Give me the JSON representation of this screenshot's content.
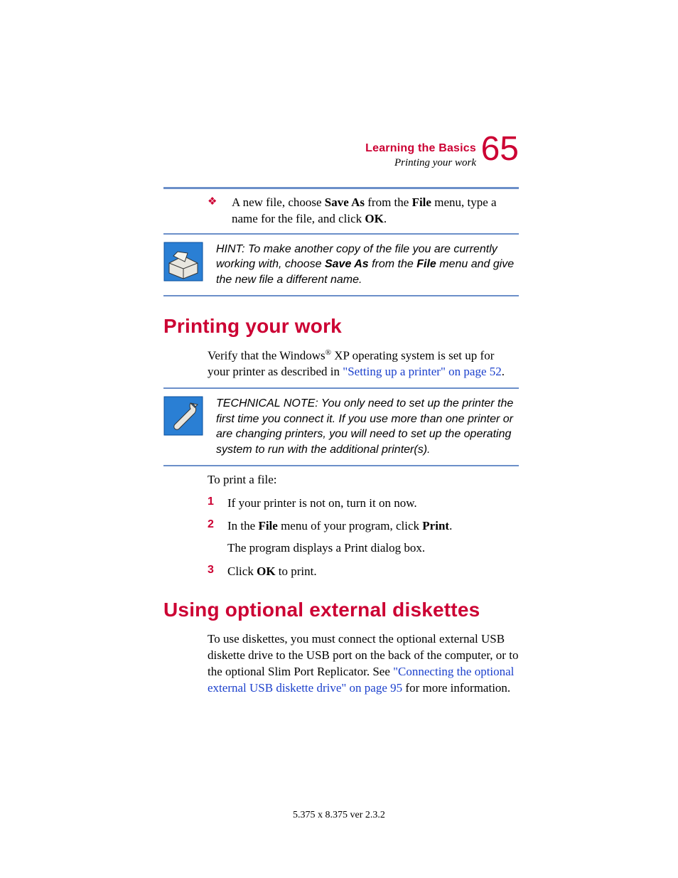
{
  "header": {
    "chapter": "Learning the Basics",
    "section": "Printing your work",
    "page": "65"
  },
  "bullet": {
    "pre": "A new file, choose ",
    "b1": "Save As",
    "mid1": " from the ",
    "b2": "File",
    "mid2": " menu, type a name for the file, and click ",
    "b3": "OK",
    "end": "."
  },
  "hint": {
    "lead": "HINT: To make another copy of the file you are currently working with, choose ",
    "b1": "Save As",
    "mid": " from the ",
    "b2": "File",
    "end": " menu and give the new file a different name."
  },
  "h2a": "Printing your work",
  "p1": {
    "t1": "Verify that the Windows",
    "reg": "®",
    "t2": " XP operating system is set up for your printer as described in ",
    "link": "\"Setting up a printer\" on page 52",
    "end": "."
  },
  "tech": "TECHNICAL NOTE: You only need to set up the printer the first time you connect it. If you use more than one printer or are changing printers, you will need to set up the operating system to run with the additional printer(s).",
  "p2": "To print a file:",
  "s1": {
    "n": "1",
    "t": "If your printer is not on, turn it on now."
  },
  "s2": {
    "n": "2",
    "pre": "In the ",
    "b1": "File",
    "mid": " menu of your program, click ",
    "b2": "Print",
    "end": ".",
    "sub": "The program displays a Print dialog box."
  },
  "s3": {
    "n": "3",
    "pre": "Click ",
    "b1": "OK",
    "end": " to print."
  },
  "h2b": "Using optional external diskettes",
  "p3": {
    "t1": "To use diskettes, you must connect the optional external USB diskette drive to the USB port on the back of the computer, or to the optional Slim Port Replicator. See ",
    "link": "\"Connecting the optional external USB diskette drive\" on page 95",
    "t2": " for more information."
  },
  "footer": "5.375 x 8.375 ver 2.3.2"
}
